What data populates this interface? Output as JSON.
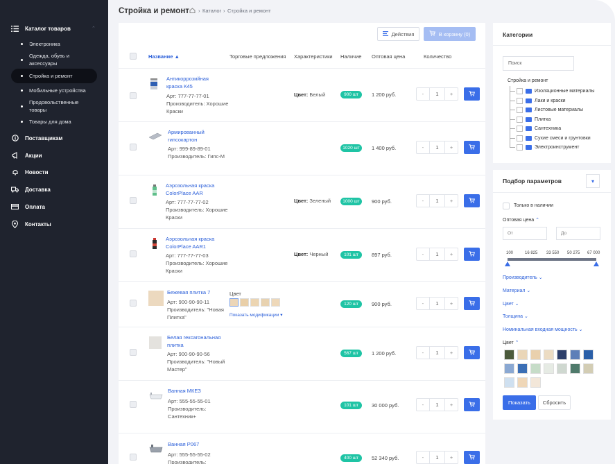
{
  "sidebar": {
    "catalog_label": "Каталог товаров",
    "subitems": [
      "Электроника",
      "Одежда, обувь и аксессуары",
      "Стройка и ремонт",
      "Мобильные устройства",
      "Продовольственные товары",
      "Товары для дома"
    ],
    "items": [
      "Поставщикам",
      "Акции",
      "Новости",
      "Доставка",
      "Оплата",
      "Контакты"
    ]
  },
  "header": {
    "title": "Стройка и ремонт",
    "breadcrumbs": [
      "Каталог",
      "Стройка и ремонт"
    ]
  },
  "toolbar": {
    "actions_label": "Действия",
    "cart_label": "В корзину (0)"
  },
  "table": {
    "headers": [
      "Название",
      "Торговые предложения",
      "Характеристики",
      "Наличие",
      "Оптовая цена",
      "Количество"
    ],
    "rows": [
      {
        "name": "Антикоррозийная краска К45",
        "sku": "Арт: 777-77-77-01",
        "maker": "Производитель: Хорошие Краски",
        "color_label": "Цвет:",
        "color": "Белый",
        "stock": "900 шт",
        "price": "1 200 руб.",
        "qty": "1"
      },
      {
        "name": "Армированный гипсокартон",
        "sku": "Арт: 999-89-89-01",
        "maker": "Производитель: Гипс-М",
        "color_label": "",
        "color": "",
        "stock": "1020 шт",
        "price": "1 400 руб.",
        "qty": "1"
      },
      {
        "name": "Аэрозольная краска ColorPlace AAR",
        "sku": "Арт: 777-77-77-02",
        "maker": "Производитель: Хорошие Краски",
        "color_label": "Цвет:",
        "color": "Зеленый",
        "stock": "1000 шт",
        "price": "900 руб.",
        "qty": "1"
      },
      {
        "name": "Аэрозольная краска ColorPlace AAR1",
        "sku": "Арт: 777-77-77-03",
        "maker": "Производитель: Хорошие Краски",
        "color_label": "Цвет:",
        "color": "Черный",
        "stock": "101 шт",
        "price": "897 руб.",
        "qty": "1"
      },
      {
        "name": "Бежевая плитка 7",
        "sku": "Арт: 900-90-90-11",
        "maker": "Производитель: \"Новая Плитка\"",
        "offer_label": "Цвет",
        "offer_link": "Показать модификации",
        "stock": "120 шт",
        "price": "900 руб.",
        "qty": "1"
      },
      {
        "name": "Белая гексагональная плитка",
        "sku": "Арт: 900-90-90-56",
        "maker": "Производитель: \"Новый Мастер\"",
        "stock": "567 шт",
        "price": "1 200 руб.",
        "qty": "1"
      },
      {
        "name": "Ванная МКЕЗ",
        "sku": "Арт: 555-55-55-01",
        "maker": "Производитель: Сантехник+",
        "stock": "101 шт",
        "price": "30 000 руб.",
        "qty": "1"
      },
      {
        "name": "Ванная Р067",
        "sku": "Арт: 555-55-55-02",
        "maker": "Производитель: Сантехник+",
        "stock": "400 шт",
        "price": "52 340 руб.",
        "qty": "1"
      }
    ],
    "minus": "-",
    "plus": "+"
  },
  "categories": {
    "title": "Категории",
    "search_placeholder": "Поиск",
    "root": "Стройка и ремонт",
    "items": [
      "Изоляционные материалы",
      "Лаки и краски",
      "Листовые материалы",
      "Плитка",
      "Сантехника",
      "Сухие смеси и грунтовки",
      "Электроинструмент"
    ]
  },
  "filters": {
    "title": "Подбор параметров",
    "in_stock_label": "Только в наличии",
    "price_label": "Оптовая цена",
    "from_placeholder": "От",
    "to_placeholder": "До",
    "ticks": [
      "100",
      "16 825",
      "33 550",
      "50 275",
      "67 000"
    ],
    "links": [
      "Производитель",
      "Материал",
      "Цвет",
      "Толщина",
      "Номинальная входная мощность"
    ],
    "color_section": "Цвет",
    "apply_label": "Показать",
    "reset_label": "Сбросить",
    "accent_color": "#3a6ee8",
    "stock_badge_color": "#1fc4a5"
  }
}
